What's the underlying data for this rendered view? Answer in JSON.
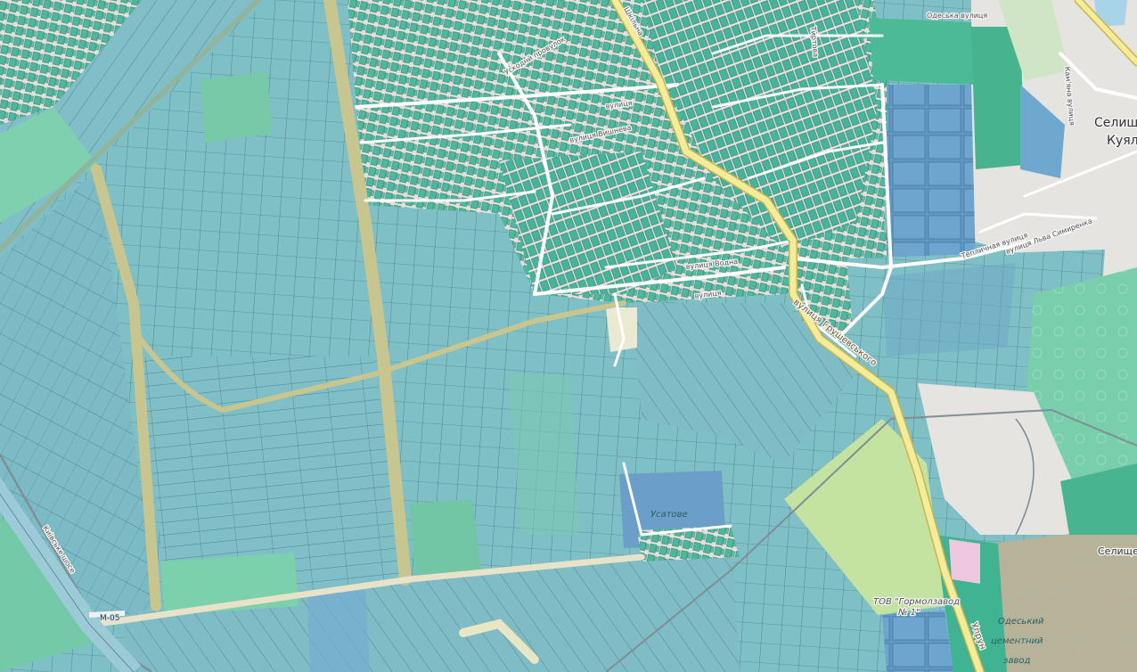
{
  "map": {
    "colors": {
      "farmland": "#7fbfc6",
      "farmland_alt": "#86c2cc",
      "orchard": "#7cd0ac",
      "residential": "#e6e4e0",
      "houses": "#47b79d",
      "industrial": "#b6d9f0",
      "industrial_zone": "#c6e29f",
      "water_basin": "#6e9ec8",
      "track": "#c6c48f",
      "main_road": "#f4ec9a",
      "main_road_casing": "#c9b840",
      "street": "#ffffff",
      "railway": "#8a9aa0",
      "quarry": "#b8b39b"
    },
    "labels": {
      "street_ukradna": "Ускоднй провулок",
      "street_ukr1": "вулиця",
      "street_vyshneva": "вулиця Вишнева",
      "street_vodna": "вулиця Водна",
      "street_vulytsia": "вулиця",
      "street_kamianna": "Кам'яна вулиця",
      "street_odeska": "Одеська вулиця",
      "street_teplychna": "Тепличная вулиця",
      "street_lva": "вулиця Льва Симиренка",
      "street_hrushevskoho": "вулиця Грушевського",
      "street_shkilna": "Шкільна",
      "street_tyrtova": "Тиртова",
      "street_uprunt": "Упрун",
      "route_m05": "М-05",
      "kyivske_shose": "Київське шосе",
      "place_selyshche_kuial": "Селище Куял",
      "place_selyshche": "Селище",
      "place_selyshche_n": "Селище Н",
      "place_usatove": "Усатове",
      "tov_tormolzavod": "ТОВ \"Гормолзавод",
      "tov_no": "№ 1\"",
      "odeskyi_1": "Одеський",
      "odeskyi_2": "цементний",
      "odeskyi_3": "завод"
    }
  }
}
